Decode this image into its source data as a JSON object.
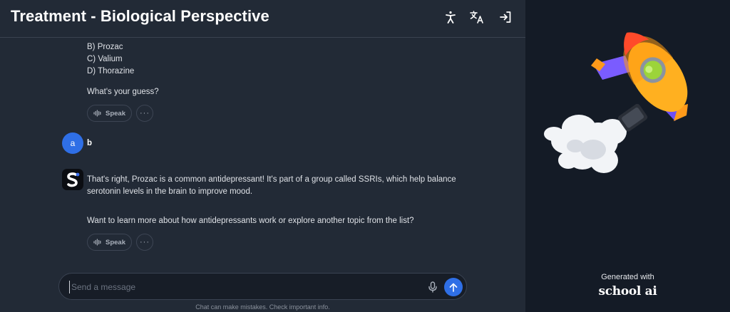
{
  "header": {
    "title": "Treatment - Biological Perspective",
    "icons": [
      "accessibility-icon",
      "translate-icon",
      "exit-icon"
    ]
  },
  "messages": {
    "bot1": {
      "options": [
        "B) Prozac",
        "C) Valium",
        "D) Thorazine"
      ],
      "prompt": "What's your guess?",
      "speak_label": "Speak"
    },
    "user1": {
      "avatar_letter": "a",
      "text": "b"
    },
    "bot2": {
      "line1": "That's right, Prozac is a common antidepressant! It's part of a group called SSRIs, which help balance",
      "line2": "serotonin levels in the brain to improve mood.",
      "line3": "Want to learn more about how antidepressants work or explore another topic from the list?",
      "speak_label": "Speak"
    }
  },
  "composer": {
    "placeholder": "Send a message",
    "disclaimer": "Chat can make mistakes. Check important info."
  },
  "sidebar": {
    "generated_label": "Generated with",
    "brand": "school ai"
  },
  "colors": {
    "accent": "#2f6fe6",
    "background": "#222a36",
    "sidebar": "#141b26"
  }
}
